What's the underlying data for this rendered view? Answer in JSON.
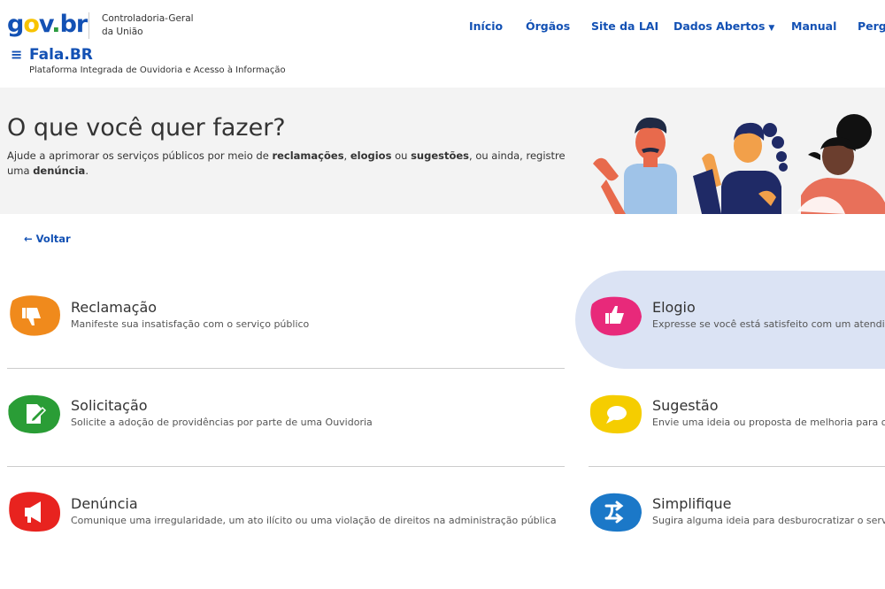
{
  "header": {
    "logo_parts": [
      "g",
      "o",
      "v",
      ".",
      "br"
    ],
    "org_line1": "Controladoria-Geral",
    "org_line2": "da União",
    "nav": [
      {
        "label": "Início"
      },
      {
        "label": "Órgãos"
      },
      {
        "label": "Site da LAI"
      },
      {
        "label": "Dados Abertos",
        "has_dropdown": true
      },
      {
        "label": "Manual"
      },
      {
        "label": "Pergu"
      }
    ],
    "menu_icon": "hamburger-icon",
    "brand": "Fala.BR",
    "brand_sub": "Plataforma Integrada de Ouvidoria e Acesso à Informação"
  },
  "banner": {
    "title": "O que você quer fazer?",
    "desc_1": "Ajude a aprimorar os serviços públicos por meio de ",
    "kw_1": "reclamações",
    "sep_1": ", ",
    "kw_2": "elogios",
    "sep_2": " ou ",
    "kw_3": "sugestões",
    "desc_2": ", ou ainda, registre uma ",
    "kw_4": "denúncia",
    "desc_3": "."
  },
  "back_label": "Voltar",
  "options": [
    {
      "title": "Reclamação",
      "desc": "Manifeste sua insatisfação com o serviço público",
      "icon": "thumbs-down-icon",
      "color": "#f08a1c"
    },
    {
      "title": "Elogio",
      "desc": "Expresse se você está satisfeito com um atendir",
      "icon": "thumbs-up-icon",
      "color": "#e8297a"
    },
    {
      "title": "Solicitação",
      "desc": "Solicite a adoção de providências por parte de uma Ouvidoria",
      "icon": "edit-document-icon",
      "color": "#2a9d36"
    },
    {
      "title": "Sugestão",
      "desc": "Envie uma ideia ou proposta de melhoria para o",
      "icon": "speech-bubble-icon",
      "color": "#f5cd00"
    },
    {
      "title": "Denúncia",
      "desc": "Comunique uma irregularidade, um ato ilícito ou uma violação de direitos na administração pública",
      "icon": "megaphone-icon",
      "color": "#e8231f"
    },
    {
      "title": "Simplifique",
      "desc": "Sugira alguma ideia para desburocratizar o serv",
      "icon": "shuffle-arrows-icon",
      "color": "#1b78c8"
    }
  ],
  "colors": {
    "primary": "#1351b4",
    "highlight": "#dbe3f4",
    "banner_bg": "#f3f3f3"
  }
}
